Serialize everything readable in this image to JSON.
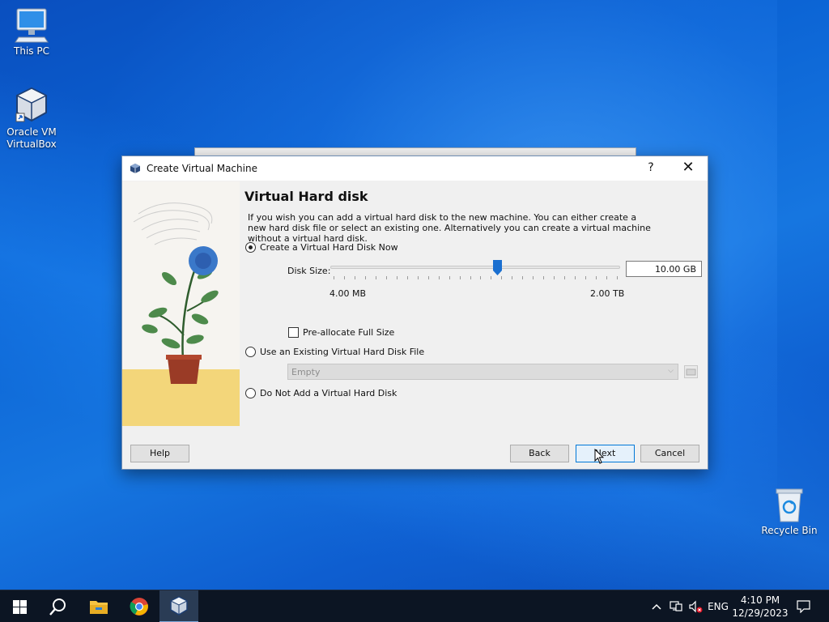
{
  "desktop": {
    "icons": {
      "this_pc": "This PC",
      "virtualbox_line1": "Oracle VM",
      "virtualbox_line2": "VirtualBox",
      "recycle_bin": "Recycle Bin"
    }
  },
  "dialog": {
    "title": "Create Virtual Machine",
    "help_glyph": "?",
    "close_glyph": "✕",
    "heading": "Virtual Hard disk",
    "description": "If you wish you can add a virtual hard disk to the new machine. You can either create a new hard disk file or select an existing one. Alternatively you can create a virtual machine without a virtual hard disk.",
    "options": {
      "create_now": {
        "label": "Create a Virtual Hard Disk Now",
        "checked": true
      },
      "use_existing": {
        "label": "Use an Existing Virtual Hard Disk File",
        "checked": false
      },
      "do_not_add": {
        "label": "Do Not Add a Virtual Hard Disk",
        "checked": false
      }
    },
    "disk_size": {
      "label": "Disk Size:",
      "value": "10.00 GB",
      "slider_fraction": 0.58,
      "min_label": "4.00 MB",
      "max_label": "2.00 TB"
    },
    "preallocate_label": "Pre-allocate Full Size",
    "existing_file_combo": "Empty",
    "buttons": {
      "help": "Help",
      "back": "Back",
      "next": "Next",
      "cancel": "Cancel"
    }
  },
  "taskbar": {
    "language": "ENG",
    "time": "4:10 PM",
    "date": "12/29/2023"
  },
  "colors": {
    "accent": "#0078d7",
    "taskbar": "#0c1523"
  }
}
